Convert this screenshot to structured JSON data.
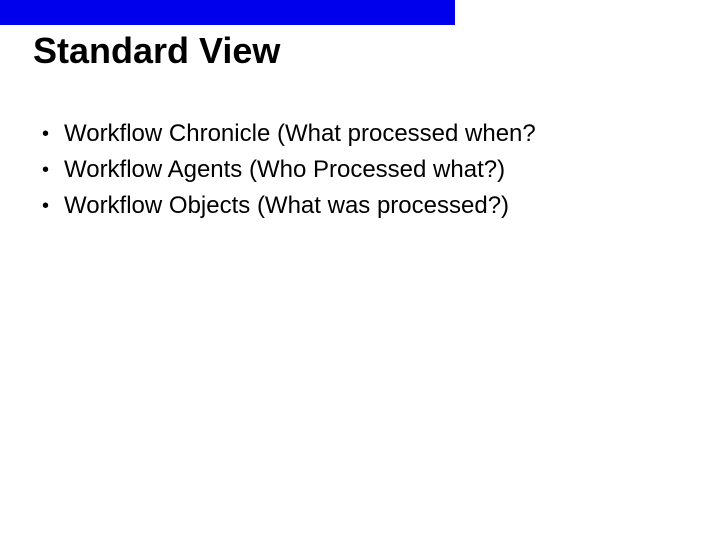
{
  "colors": {
    "accent": "#0000ED"
  },
  "title": "Standard View",
  "bullets": [
    "Workflow Chronicle (What processed when?",
    "Workflow Agents (Who Processed what?)",
    "Workflow Objects (What was processed?)"
  ]
}
